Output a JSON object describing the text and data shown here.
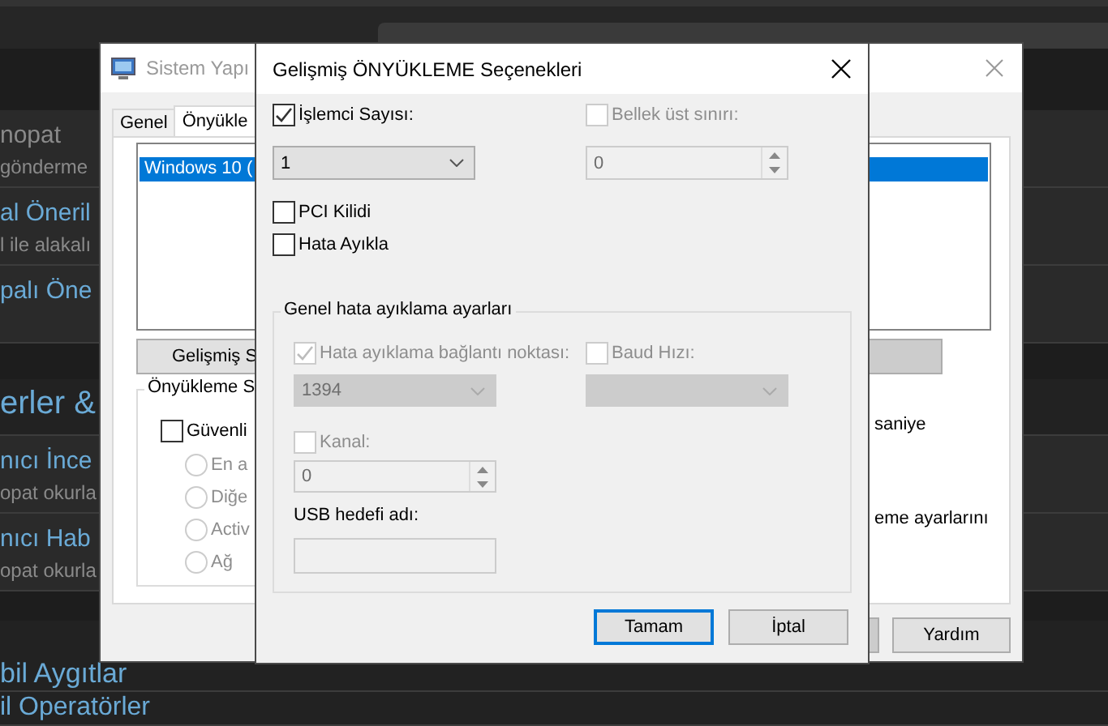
{
  "background": {
    "rows": [
      {
        "kind": "item",
        "title": "nopat",
        "subtitle": "gönderme",
        "muted": true
      },
      {
        "kind": "item",
        "title": "al Öneril",
        "subtitle": "l ile alakalı",
        "muted": false
      },
      {
        "kind": "item",
        "title": "palı Öne",
        "muted": false
      },
      {
        "kind": "category",
        "title": "erler &"
      },
      {
        "kind": "item",
        "title": "nıcı İnce",
        "subtitle": "opat okurla",
        "muted": false
      },
      {
        "kind": "item",
        "title": "nıcı Hab",
        "subtitle": "opat okurla",
        "muted": false
      },
      {
        "kind": "section",
        "title": "bil Aygıtlar"
      },
      {
        "kind": "link",
        "title": "il Operatörler"
      }
    ]
  },
  "back_window": {
    "title": "Sistem Yapı",
    "tabs": [
      {
        "label": "Genel",
        "selected": false
      },
      {
        "label": "Önyükle",
        "selected": true
      }
    ],
    "boot_list": [
      {
        "label": "Windows 10 (",
        "selected": true
      }
    ],
    "advanced_button": "Gelişmiş S",
    "boot_group": {
      "legend": "Önyükleme S",
      "safe_boot": {
        "label": "Güvenli",
        "checked": false
      },
      "options": [
        {
          "label": "En a",
          "selected": false,
          "disabled": true
        },
        {
          "label": "Diğe",
          "selected": false,
          "disabled": true
        },
        {
          "label": "Activ",
          "selected": false,
          "disabled": true
        },
        {
          "label": "Ağ",
          "selected": false,
          "disabled": true
        }
      ]
    },
    "timeout_unit": "saniye",
    "settings_text": "eme ayarlarını",
    "buttons": [
      "Yardım"
    ]
  },
  "dialog": {
    "title": "Gelişmiş ÖNYÜKLEME Seçenekleri",
    "processor_count": {
      "label": "İşlemci Sayısı:",
      "checked": true,
      "value": "1"
    },
    "max_memory": {
      "label": "Bellek üst sınırı:",
      "checked": false,
      "disabled": true,
      "value": "0"
    },
    "pci_lock": {
      "label": "PCI Kilidi",
      "checked": false
    },
    "debug": {
      "label": "Hata Ayıkla",
      "checked": false
    },
    "debug_group": {
      "legend": "Genel hata ayıklama ayarları",
      "debug_port": {
        "label": "Hata ayıklama bağlantı noktası:",
        "checked": true,
        "disabled": true,
        "value": "1394"
      },
      "baud_rate": {
        "label": "Baud Hızı:",
        "checked": false,
        "disabled": true
      },
      "channel": {
        "label": "Kanal:",
        "checked": false,
        "disabled": true,
        "value": "0"
      },
      "usb_target": {
        "label": "USB hedefi adı:",
        "disabled": true
      }
    },
    "buttons": [
      {
        "label": "Tamam",
        "default": true
      },
      {
        "label": "İptal",
        "default": false
      }
    ]
  }
}
